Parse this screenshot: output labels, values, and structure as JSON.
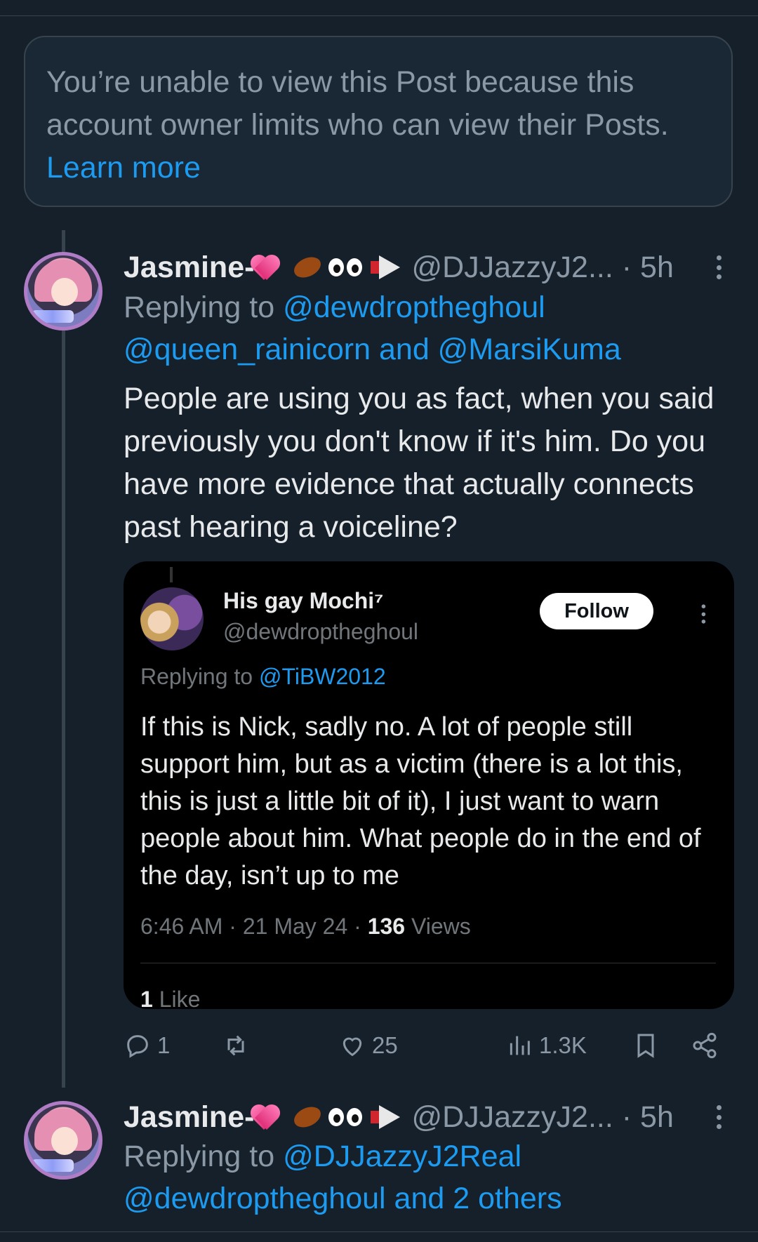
{
  "restricted_notice": {
    "text": "You’re unable to view this Post because this account owner limits who can view their Posts. ",
    "link": "Learn more"
  },
  "posts": [
    {
      "name": "Jasmine-",
      "emojis": [
        "heart-icon",
        "cockroach-icon",
        "eyes-icon",
        "megaphone-icon"
      ],
      "handle": "@DJJazzyJ2... · 5h",
      "replying_prefix": "Replying to ",
      "replying_line1": "@dewdroptheghoul",
      "replying_line2": "@queen_rainicorn and @MarsiKuma",
      "text": "People are using you as fact, when you said previously you don't know if it's him. Do you have more evidence that actually connects past hearing a voiceline?",
      "quote": {
        "name": "His gay Mochi⁷",
        "handle": "@dewdroptheghoul",
        "follow_label": "Follow",
        "replying_prefix": "Replying to ",
        "replying_to": "@TiBW2012",
        "text": "If this is Nick, sadly no. A lot of people still support him, but as a victim (there is a lot this, this is just a little bit of it), I just want to warn people about him. What people do in the end of the day, isn’t up to me",
        "time": "6:46 AM · 21 May 24 · ",
        "views_count": "136",
        "views_label": " Views",
        "likes_count": "1",
        "likes_label": " Like"
      },
      "actions": {
        "replies": "1",
        "reposts": "",
        "likes": "25",
        "views": "1.3K"
      }
    },
    {
      "name": "Jasmine-",
      "handle": "@DJJazzyJ2... · 5h",
      "replying_prefix": "Replying to ",
      "replying_line1": "@DJJazzyJ2Real",
      "replying_line2": "@dewdroptheghoul and 2 others"
    }
  ],
  "colors": {
    "background": "#15202b",
    "accent": "#1d9bf0",
    "muted": "#8b98a5"
  }
}
